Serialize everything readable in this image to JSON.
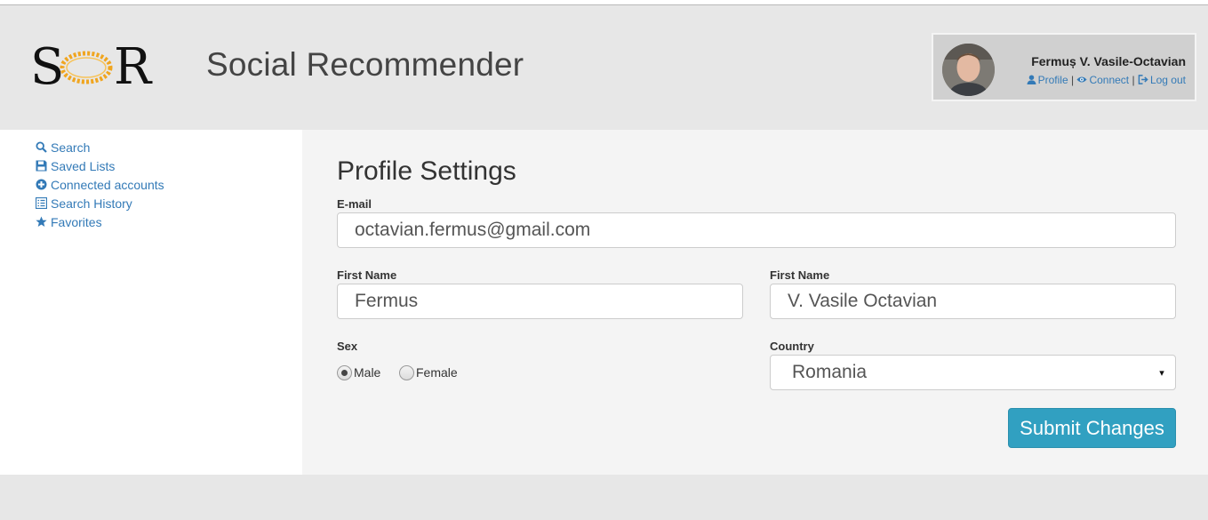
{
  "header": {
    "logo": {
      "left_letter": "S",
      "right_letter": "R"
    },
    "site_title": "Social Recommender",
    "user": {
      "name": "Fermuș V. Vasile-Octavian",
      "links": [
        {
          "label": "Profile",
          "icon": "user-icon"
        },
        {
          "label": "Connect",
          "icon": "eye-icon"
        },
        {
          "label": "Log out",
          "icon": "logout-icon"
        }
      ],
      "separator": "|"
    }
  },
  "sidebar": {
    "items": [
      {
        "label": "Search",
        "icon": "search-icon"
      },
      {
        "label": "Saved Lists",
        "icon": "floppy-disk-icon"
      },
      {
        "label": "Connected accounts",
        "icon": "plus-circle-icon"
      },
      {
        "label": "Search History",
        "icon": "list-icon"
      },
      {
        "label": "Favorites",
        "icon": "star-icon"
      }
    ]
  },
  "form": {
    "title": "Profile Settings",
    "email": {
      "label": "E-mail",
      "value": "octavian.fermus@gmail.com"
    },
    "first_name": {
      "label": "First Name",
      "value": "Fermus"
    },
    "last_name": {
      "label": "First Name",
      "value": "V. Vasile Octavian"
    },
    "sex": {
      "label": "Sex",
      "options": [
        {
          "label": "Male",
          "selected": true
        },
        {
          "label": "Female",
          "selected": false
        }
      ]
    },
    "country": {
      "label": "Country",
      "value": "Romania",
      "caret": "▾"
    },
    "submit_label": "Submit Changes"
  },
  "colors": {
    "link": "#337ab7",
    "submit": "#31a0c1",
    "header_bg": "#e7e7e7",
    "main_bg": "#f4f4f4"
  }
}
